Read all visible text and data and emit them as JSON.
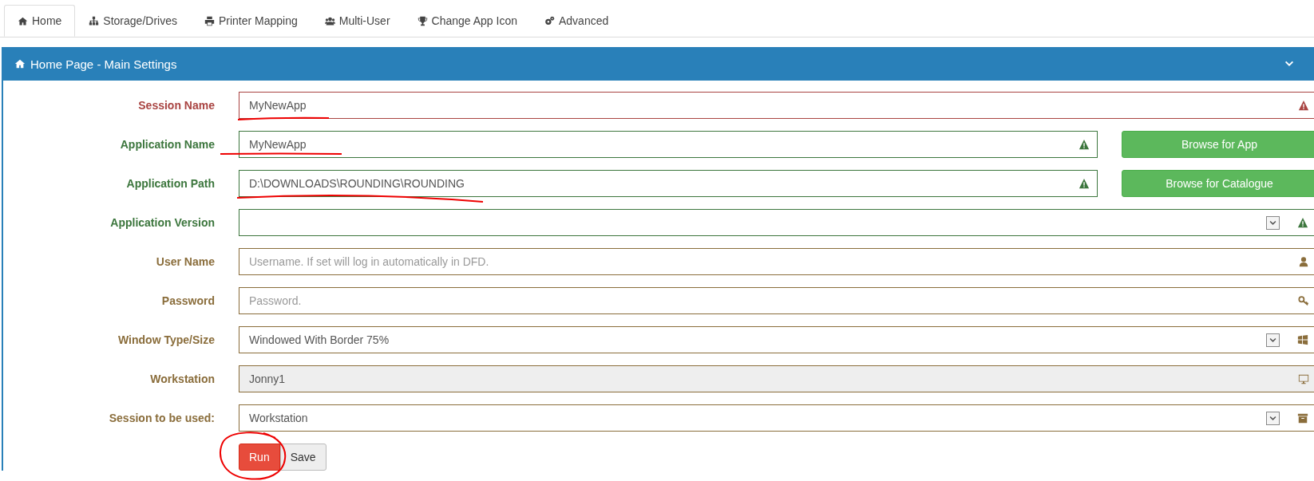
{
  "tabs": [
    {
      "label": "Home",
      "selected": true
    },
    {
      "label": "Storage/Drives",
      "selected": false
    },
    {
      "label": "Printer Mapping",
      "selected": false
    },
    {
      "label": "Multi-User",
      "selected": false
    },
    {
      "label": "Change App Icon",
      "selected": false
    },
    {
      "label": "Advanced",
      "selected": false
    }
  ],
  "panel": {
    "title": "Home Page - Main Settings"
  },
  "fields": [
    {
      "label": "Session Name",
      "kind": "text",
      "error": true,
      "valid": false,
      "value": "MyNewApp"
    },
    {
      "label": "Application Name",
      "kind": "text",
      "error": false,
      "valid": true,
      "value": "MyNewApp",
      "action": "Browse for App"
    },
    {
      "label": "Application Path",
      "kind": "text",
      "error": false,
      "valid": true,
      "value": "D:\\DOWNLOADS\\ROUNDING\\ROUNDING",
      "action": "Browse for Catalogue"
    },
    {
      "label": "Application Version",
      "kind": "select",
      "error": false,
      "valid": true
    },
    {
      "label": "User Name",
      "kind": "text",
      "error": false,
      "valid": false,
      "placeholder": "Username. If set will log in automatically in DFD."
    },
    {
      "label": "Password",
      "kind": "text",
      "error": false,
      "valid": false,
      "placeholder": "Password."
    },
    {
      "label": "Window Type/Size",
      "kind": "select",
      "error": false,
      "valid": false,
      "value": "Windowed With Border 75%"
    },
    {
      "label": "Workstation",
      "kind": "readonly",
      "error": false,
      "valid": false,
      "value": "Jonny1"
    },
    {
      "label": "Session to be used:",
      "kind": "select",
      "error": false,
      "valid": false,
      "value": "Workstation"
    }
  ],
  "buttons": [
    {
      "label": "Run",
      "kind": "danger"
    },
    {
      "label": "Save",
      "kind": "default"
    }
  ]
}
